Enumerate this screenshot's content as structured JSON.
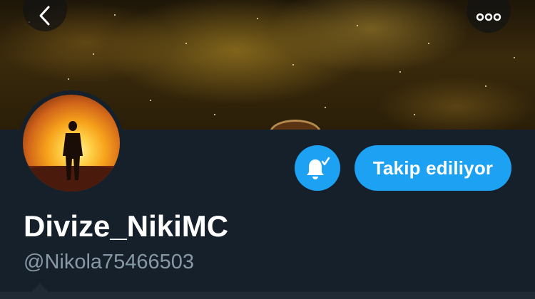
{
  "profile": {
    "display_name": "Divize_NikiMC",
    "handle": "@Nikola75466503",
    "follow_button_label": "Takip ediliyor"
  },
  "icons": {
    "back": "chevron-left-icon",
    "more": "more-horizontal-icon",
    "notifications": "bell-check-icon"
  },
  "colors": {
    "accent": "#1da1f2",
    "background": "#15202b",
    "secondary_text": "#8899a6",
    "primary_text": "#ffffff"
  }
}
